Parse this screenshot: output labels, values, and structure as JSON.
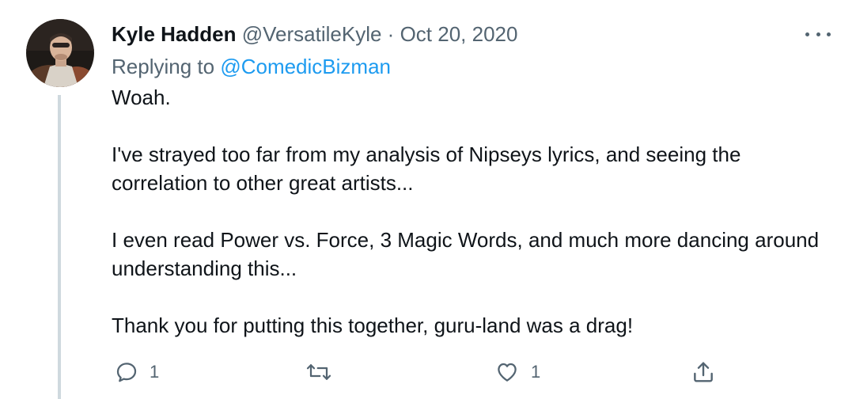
{
  "tweet": {
    "author_name": "Kyle Hadden",
    "handle": "@VersatileKyle",
    "separator": "·",
    "date": "Oct 20, 2020",
    "replying_prefix": "Replying to",
    "replying_to": "@ComedicBizman",
    "paragraphs": [
      "Woah.",
      "I've strayed too far from my analysis of Nipseys lyrics, and seeing the correlation to other great artists...",
      "I even read Power vs. Force, 3 Magic Words, and much more dancing around understanding this...",
      "Thank you for putting this together, guru-land was a drag!"
    ]
  },
  "actions": {
    "reply_count": "1",
    "retweet_count": "",
    "like_count": "1"
  },
  "icons": {
    "more": "more-icon",
    "reply": "reply-icon",
    "retweet": "retweet-icon",
    "like": "heart-icon",
    "share": "share-icon"
  },
  "colors": {
    "text": "#0f1419",
    "secondary": "#536471",
    "link": "#1d9bf0",
    "thread_line": "#cfd9de"
  }
}
